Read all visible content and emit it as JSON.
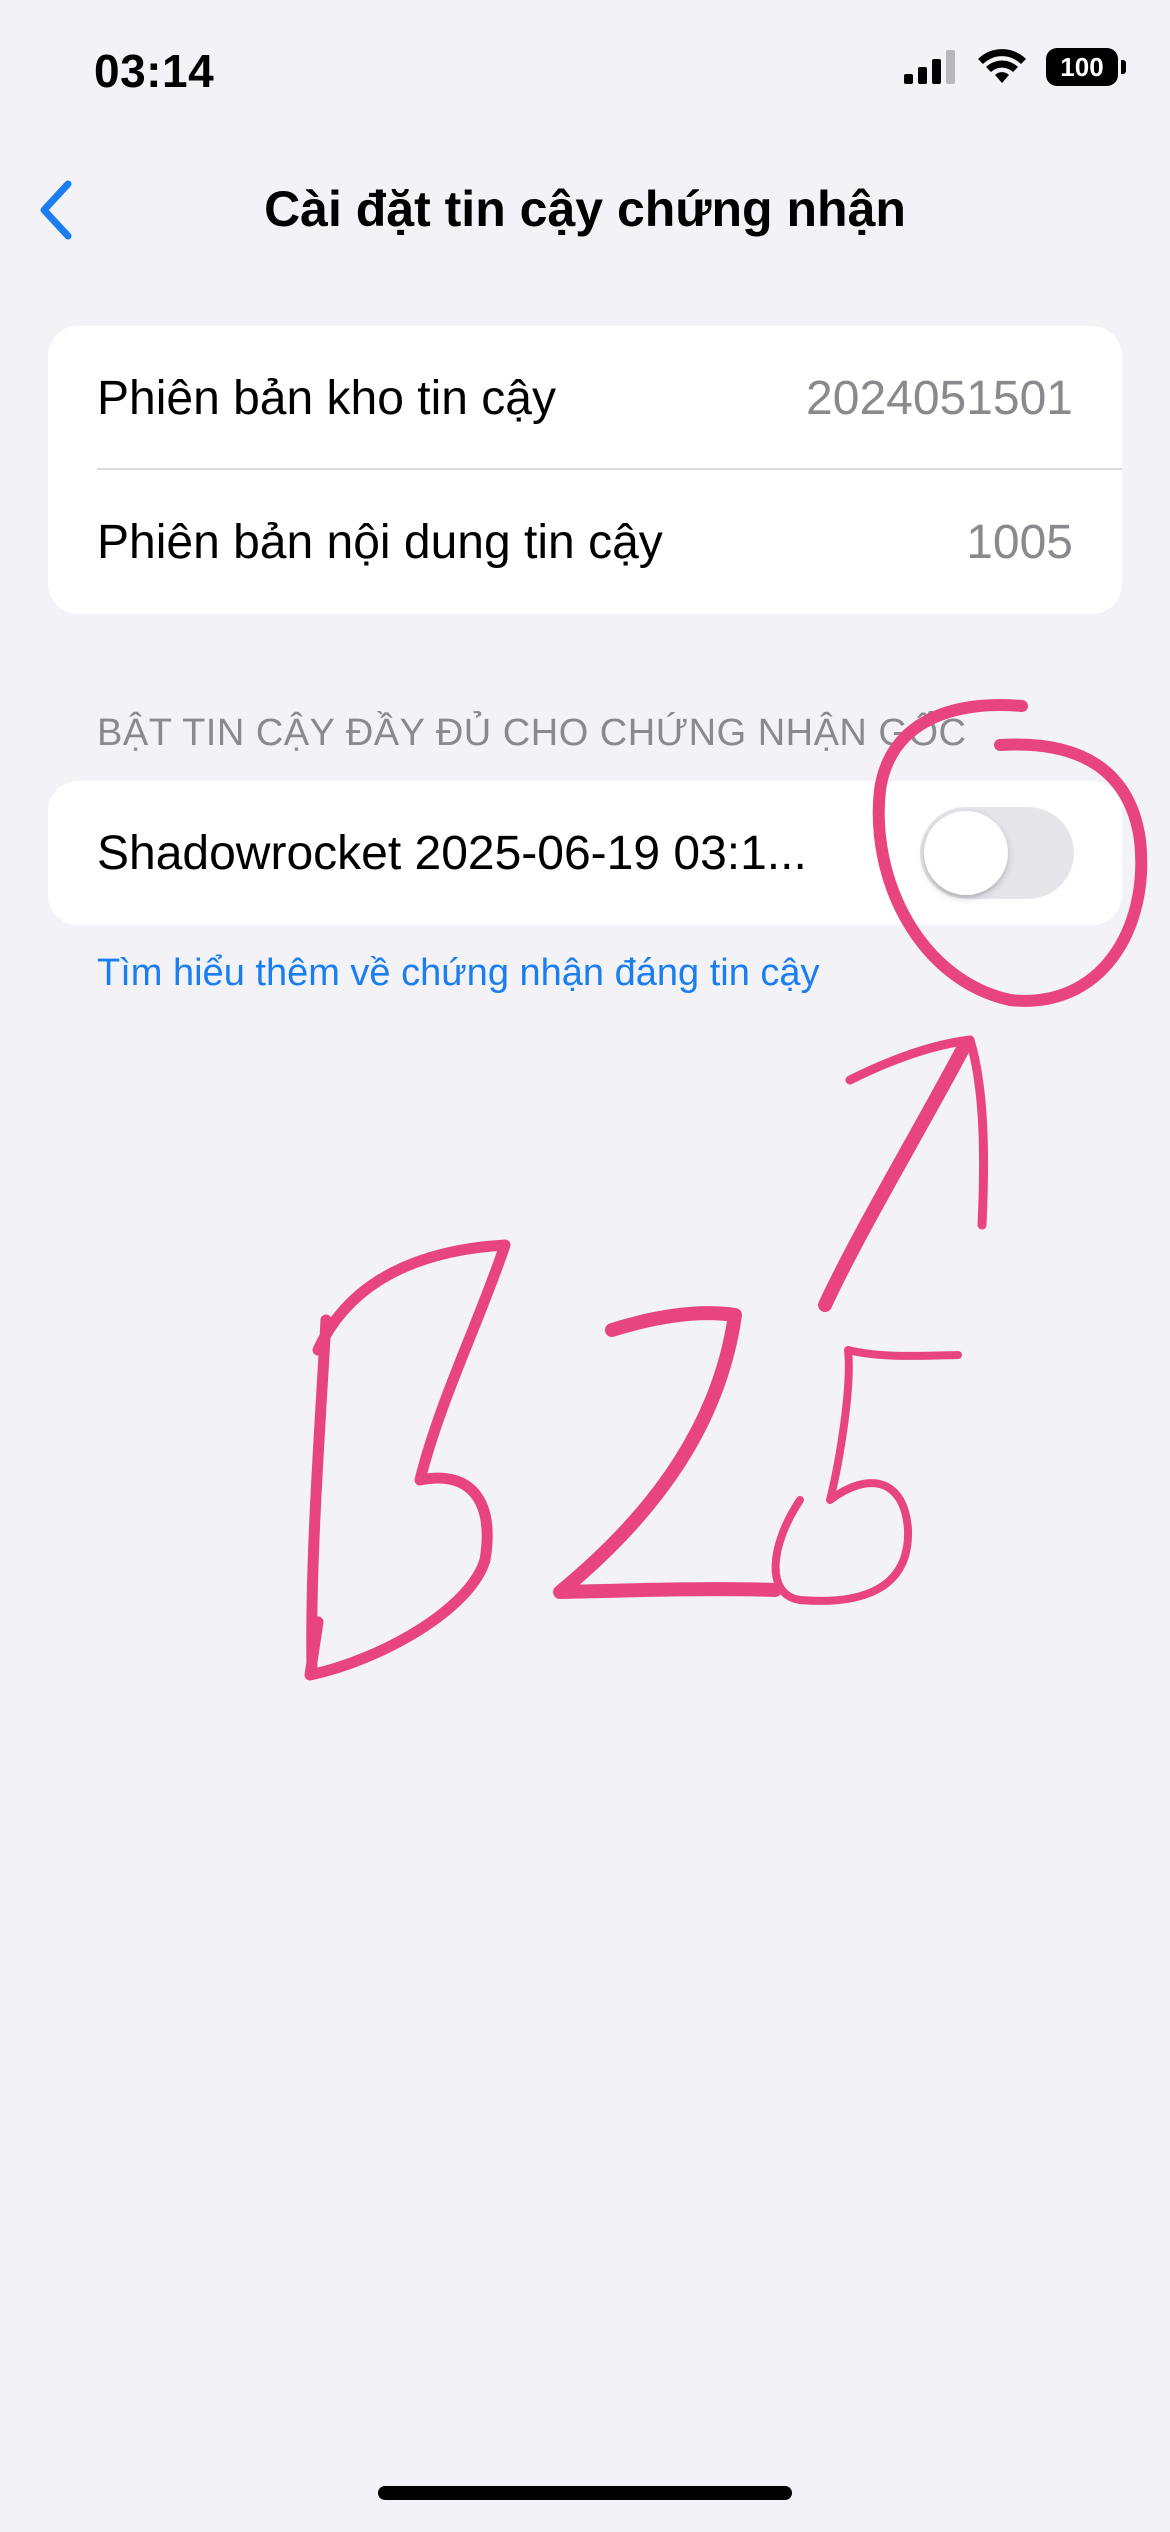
{
  "status_bar": {
    "time": "03:14",
    "battery_percent": "100"
  },
  "nav": {
    "title": "Cài đặt tin cậy chứng nhận",
    "back_icon": "chevron-left-icon"
  },
  "trust_info": [
    {
      "label": "Phiên bản kho tin cậy",
      "value": "2024051501"
    },
    {
      "label": "Phiên bản nội dung tin cậy",
      "value": "1005"
    }
  ],
  "root_certs": {
    "section_header": "BẬT TIN CẬY ĐẦY ĐỦ CHO CHỨNG NHẬN GỐC",
    "items": [
      {
        "label": "Shadowrocket 2025-06-19 03:1...",
        "enabled": false
      }
    ],
    "learn_more_link": "Tìm hiểu thêm về chứng nhận đáng tin cậy"
  },
  "annotation": {
    "handwritten_text": "B25",
    "color": "#e8457f"
  },
  "colors": {
    "accent": "#1a7df0",
    "background": "#f2f2f7",
    "secondary_text": "#8a8a8e",
    "toggle_off": "#e5e5ea"
  }
}
